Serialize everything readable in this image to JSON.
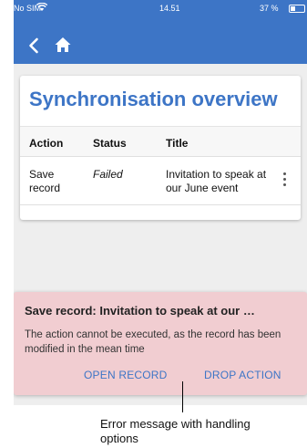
{
  "status_bar": {
    "carrier": "No SIM",
    "time": "14.51",
    "battery": "37 %"
  },
  "header": {
    "back_icon": "chevron-left-icon",
    "home_icon": "home-icon"
  },
  "card": {
    "title": "Synchronisation overview",
    "columns": [
      "Action",
      "Status",
      "Title"
    ],
    "rows": [
      {
        "action": "Save record",
        "status": "Failed",
        "title": "Invitation to speak at our June event"
      }
    ]
  },
  "error": {
    "title": "Save record: Invitation to speak at our …",
    "message": "The action cannot be executed, as the record has been modified in the mean time",
    "open_label": "OPEN RECORD",
    "drop_label": "DROP ACTION"
  },
  "annotation": {
    "caption": "Error message with handling options"
  }
}
